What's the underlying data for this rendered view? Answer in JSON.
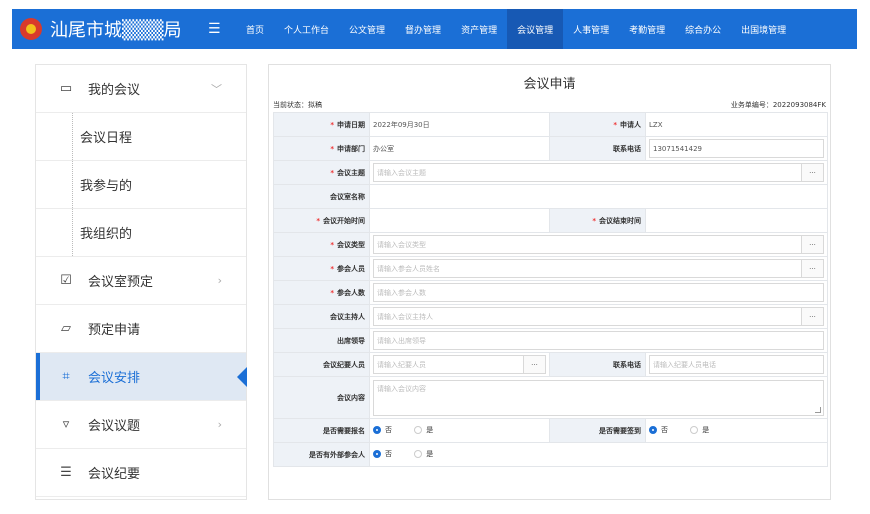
{
  "brand": {
    "title": "汕尾市城▒▒▒局"
  },
  "nav": {
    "items": [
      "首页",
      "个人工作台",
      "公文管理",
      "督办管理",
      "资产管理",
      "会议管理",
      "人事管理",
      "考勤管理",
      "综合办公",
      "出国境管理"
    ],
    "active_index": 5
  },
  "sidebar": {
    "items": [
      {
        "label": "我的会议",
        "icon": "meeting-list-icon",
        "chevron": "﹀",
        "kind": "group"
      },
      {
        "label": "会议日程",
        "kind": "sub"
      },
      {
        "label": "我参与的",
        "kind": "sub"
      },
      {
        "label": "我组织的",
        "kind": "sub"
      },
      {
        "label": "会议室预定",
        "icon": "calendar-check-icon",
        "chevron": "›",
        "kind": "group"
      },
      {
        "label": "预定申请",
        "icon": "form-icon",
        "kind": "group"
      },
      {
        "label": "会议安排",
        "icon": "arrange-icon",
        "kind": "group",
        "active": true
      },
      {
        "label": "会议议题",
        "icon": "topic-icon",
        "chevron": "›",
        "kind": "group"
      },
      {
        "label": "会议纪要",
        "icon": "minutes-icon",
        "kind": "group"
      }
    ]
  },
  "form": {
    "title": "会议申请",
    "status": "当前状态：拟稿",
    "business_no": "业务单编号：2022093084FK",
    "apply_date_label": "申请日期",
    "apply_date": "2022年09月30日",
    "applicant_label": "申请人",
    "applicant": "LZX",
    "dept_label": "申请部门",
    "dept": "办公室",
    "phone_label": "联系电话",
    "phone": "13071541429",
    "topic_label": "会议主题",
    "topic_placeholder": "请输入会议主题",
    "room_label": "会议室名称",
    "start_label": "会议开始时间",
    "end_label": "会议结束时间",
    "type_label": "会议类型",
    "type_placeholder": "请输入会议类型",
    "participants_label": "参会人员",
    "participants_placeholder": "请输入参会人员姓名",
    "count_label": "参会人数",
    "count_placeholder": "请输入参会人数",
    "host_label": "会议主持人",
    "host_placeholder": "请输入会议主持人",
    "leader_label": "出席领导",
    "leader_placeholder": "请输入出席领导",
    "recorder_label": "会议纪要人员",
    "recorder_placeholder": "请输入纪要人员",
    "recorder_phone_label": "联系电话",
    "recorder_phone_placeholder": "请输入纪要人员电话",
    "content_label": "会议内容",
    "content_placeholder": "请输入会议内容",
    "signup_label": "是否需要报名",
    "checkin_label": "是否需要签到",
    "external_label": "是否有外部参会人",
    "opt_no": "否",
    "opt_yes": "是",
    "dots": "···"
  }
}
